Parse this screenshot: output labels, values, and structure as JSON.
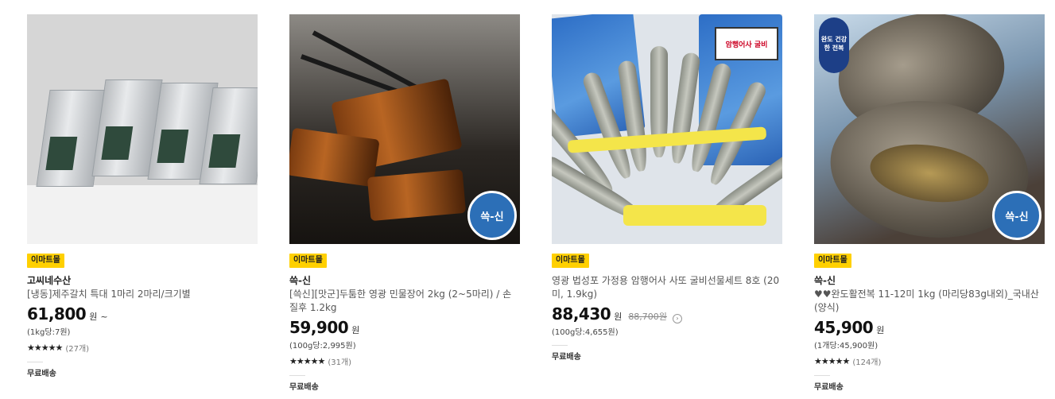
{
  "products": [
    {
      "badge": "이마트몰",
      "brand": "고씨네수산",
      "title": "[냉동]제주갈치 특대 1마리 2마리/크기별",
      "price": "61,800",
      "currency": "원",
      "price_suffix": "~",
      "original_price": "",
      "unit_price": "(1kg당:7원)",
      "stars": "★★★★★",
      "review_count": "(27개)",
      "shipping": "무료배송"
    },
    {
      "badge": "이마트몰",
      "brand": "쓱-신",
      "title": "[쓱신][맛군]두툼한 영광 민물장어 2kg (2~5마리) / 손질후 1.2kg",
      "price": "59,900",
      "currency": "원",
      "price_suffix": "",
      "original_price": "",
      "unit_price": "(100g당:2,995원)",
      "stars": "★★★★★",
      "review_count": "(31개)",
      "shipping": "무료배송",
      "image_stamp": "쓱-신"
    },
    {
      "badge": "이마트몰",
      "brand": "",
      "title": "영광 법성포 가정용 암행어사 사또 굴비선물세트 8호 (20미, 1.9kg)",
      "price": "88,430",
      "currency": "원",
      "price_suffix": "",
      "original_price": "88,700원",
      "unit_price": "(100g당:4,655원)",
      "stars": "",
      "review_count": "",
      "shipping": "무료배송",
      "image_tag": "암행어사 굴비"
    },
    {
      "badge": "이마트몰",
      "brand": "쓱-신",
      "title": "♥♥완도활전복 11-12미 1kg (마리당83g내외)_국내산(양식)",
      "price": "45,900",
      "currency": "원",
      "price_suffix": "",
      "original_price": "",
      "unit_price": "(1개당:45,900원)",
      "stars": "★★★★★",
      "review_count": "(124개)",
      "shipping": "무료배송",
      "image_stamp": "쓱-신",
      "image_logo": "완도 건강한 전복"
    }
  ],
  "colors": {
    "badge_bg": "#ffd000",
    "stamp_blue": "#2c6fb7"
  }
}
